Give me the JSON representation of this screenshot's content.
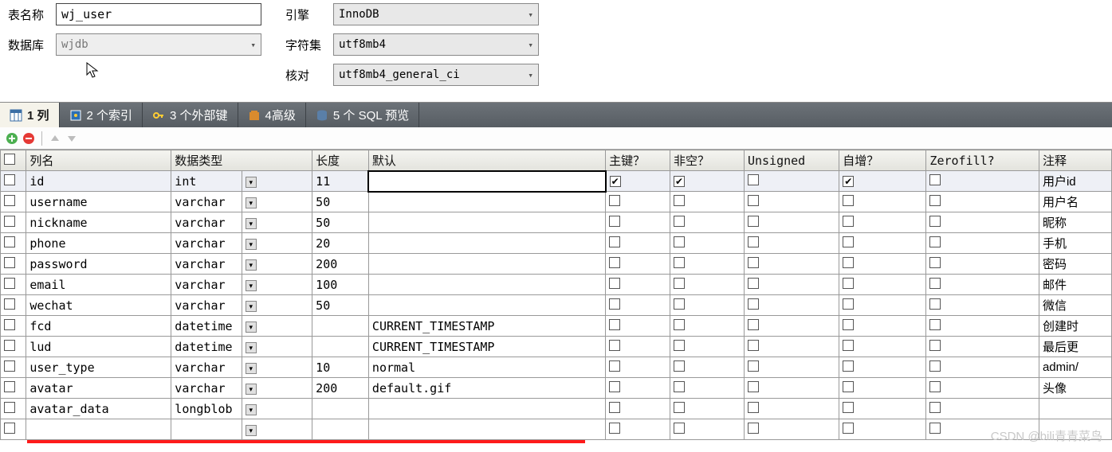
{
  "form": {
    "tableNameLabel": "表名称",
    "tableName": "wj_user",
    "databaseLabel": "数据库",
    "database": "wjdb",
    "engineLabel": "引擎",
    "engine": "InnoDB",
    "charsetLabel": "字符集",
    "charset": "utf8mb4",
    "collationLabel": "核对",
    "collation": "utf8mb4_general_ci"
  },
  "tabs": {
    "columns": "1 列",
    "indexes": "2 个索引",
    "fks": "3 个外部键",
    "advanced": "4高级",
    "sql": "5 个 SQL 预览"
  },
  "gridHeaders": {
    "name": "列名",
    "type": "数据类型",
    "length": "长度",
    "default": "默认",
    "pk": "主键？",
    "nn": "非空？",
    "unsigned": "Unsigned",
    "ai": "自增？",
    "zf": "Zerofill?",
    "comment": "注释"
  },
  "rows": [
    {
      "name": "id",
      "type": "int",
      "len": "11",
      "def": "",
      "pk": true,
      "nn": true,
      "un": false,
      "ai": true,
      "zf": false,
      "cm": "用户id",
      "sel": true
    },
    {
      "name": "username",
      "type": "varchar",
      "len": "50",
      "def": "",
      "pk": false,
      "nn": false,
      "un": false,
      "ai": false,
      "zf": false,
      "cm": "用户名"
    },
    {
      "name": "nickname",
      "type": "varchar",
      "len": "50",
      "def": "",
      "pk": false,
      "nn": false,
      "un": false,
      "ai": false,
      "zf": false,
      "cm": "昵称"
    },
    {
      "name": "phone",
      "type": "varchar",
      "len": "20",
      "def": "",
      "pk": false,
      "nn": false,
      "un": false,
      "ai": false,
      "zf": false,
      "cm": "手机"
    },
    {
      "name": "password",
      "type": "varchar",
      "len": "200",
      "def": "",
      "pk": false,
      "nn": false,
      "un": false,
      "ai": false,
      "zf": false,
      "cm": "密码"
    },
    {
      "name": "email",
      "type": "varchar",
      "len": "100",
      "def": "",
      "pk": false,
      "nn": false,
      "un": false,
      "ai": false,
      "zf": false,
      "cm": "邮件"
    },
    {
      "name": "wechat",
      "type": "varchar",
      "len": "50",
      "def": "",
      "pk": false,
      "nn": false,
      "un": false,
      "ai": false,
      "zf": false,
      "cm": "微信"
    },
    {
      "name": "fcd",
      "type": "datetime",
      "len": "",
      "def": "CURRENT_TIMESTAMP",
      "pk": false,
      "nn": false,
      "un": false,
      "ai": false,
      "zf": false,
      "cm": "创建时"
    },
    {
      "name": "lud",
      "type": "datetime",
      "len": "",
      "def": "CURRENT_TIMESTAMP",
      "pk": false,
      "nn": false,
      "un": false,
      "ai": false,
      "zf": false,
      "cm": "最后更"
    },
    {
      "name": "user_type",
      "type": "varchar",
      "len": "10",
      "def": "normal",
      "pk": false,
      "nn": false,
      "un": false,
      "ai": false,
      "zf": false,
      "cm": "admin/"
    },
    {
      "name": "avatar",
      "type": "varchar",
      "len": "200",
      "def": "default.gif",
      "pk": false,
      "nn": false,
      "un": false,
      "ai": false,
      "zf": false,
      "cm": "头像"
    },
    {
      "name": "avatar_data",
      "type": "longblob",
      "len": "",
      "def": "",
      "pk": false,
      "nn": false,
      "un": false,
      "ai": false,
      "zf": false,
      "cm": ""
    }
  ],
  "watermark": "CSDN @bili青青菜鸟"
}
